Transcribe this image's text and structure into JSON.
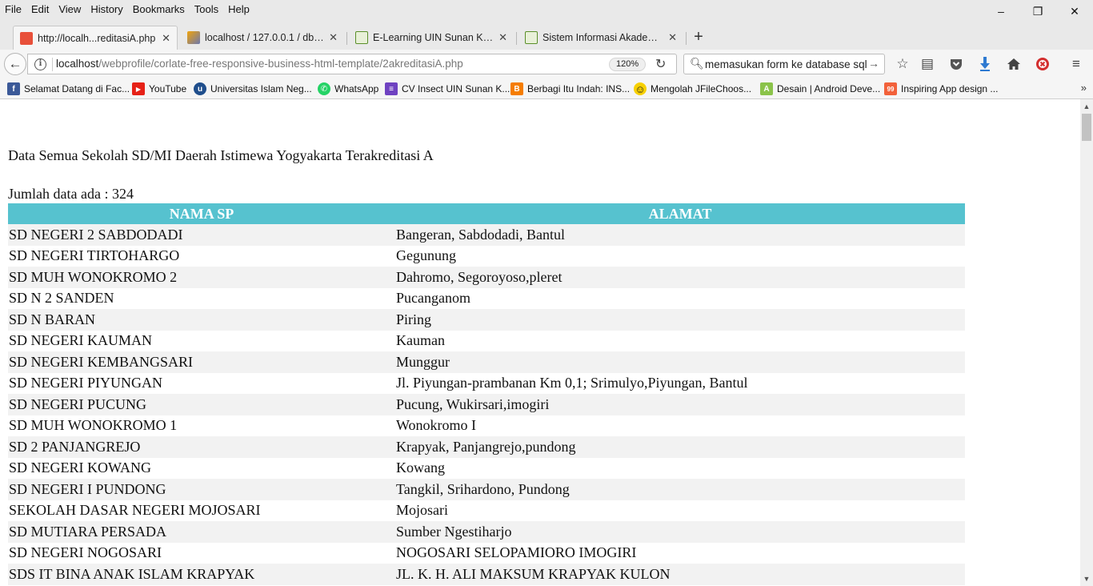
{
  "menubar": {
    "items": [
      "File",
      "Edit",
      "View",
      "History",
      "Bookmarks",
      "Tools",
      "Help"
    ]
  },
  "window_controls": {
    "minimize": "–",
    "restore": "❐",
    "close": "✕"
  },
  "tabs": [
    {
      "title": "http://localh...reditasiA.php",
      "color": "#e8503a"
    },
    {
      "title": "localhost / 127.0.0.1 / db_s...",
      "color": "#f0a30a"
    },
    {
      "title": "E-Learning UIN Sunan Kali...",
      "color": "#5a8f29"
    },
    {
      "title": "Sistem Informasi Akademi...",
      "color": "#5a8f29"
    }
  ],
  "new_tab_label": "+",
  "navbar": {
    "url_host": "localhost",
    "url_path": "/webprofile/corlate-free-responsive-business-html-template/2akreditasiA.php",
    "zoom": "120%",
    "search_value": "memasukan form ke database sql"
  },
  "bookmarks": [
    {
      "label": "Selamat Datang di Fac...",
      "icon": "facebook-icon",
      "color": "#3b5998",
      "glyph": "f"
    },
    {
      "label": "YouTube",
      "icon": "youtube-icon",
      "color": "#e62117",
      "glyph": "▶"
    },
    {
      "label": "Universitas Islam Neg...",
      "icon": "uin-icon",
      "color": "#1f4e8c",
      "glyph": "u"
    },
    {
      "label": "WhatsApp",
      "icon": "whatsapp-icon",
      "color": "#25d366",
      "glyph": "✆"
    },
    {
      "label": "CV Insect UIN Sunan K...",
      "icon": "list-icon",
      "color": "#6f42c1",
      "glyph": "≡"
    },
    {
      "label": "Berbagi Itu Indah: INS...",
      "icon": "blogger-icon",
      "color": "#f57d00",
      "glyph": "B"
    },
    {
      "label": "Mengolah JFileChoos...",
      "icon": "smiley-icon",
      "color": "#f7d000",
      "glyph": "☺"
    },
    {
      "label": "Desain | Android Deve...",
      "icon": "android-icon",
      "color": "#8bc34a",
      "glyph": "A"
    },
    {
      "label": "Inspiring App design ...",
      "icon": "99designs-icon",
      "color": "#f2613a",
      "glyph": "99"
    }
  ],
  "bookmarks_more": "»",
  "page": {
    "heading": "Data Semua Sekolah SD/MI Daerah Istimewa Yogyakarta Terakreditasi A",
    "count_label": "Jumlah data ada : 324",
    "columns": [
      "NAMA SP",
      "ALAMAT"
    ],
    "rows": [
      [
        "SD NEGERI 2 SABDODADI",
        "Bangeran, Sabdodadi, Bantul"
      ],
      [
        "SD NEGERI TIRTOHARGO",
        "Gegunung"
      ],
      [
        "SD MUH WONOKROMO 2",
        "Dahromo, Segoroyoso,pleret"
      ],
      [
        "SD N 2 SANDEN",
        "Pucanganom"
      ],
      [
        "SD N BARAN",
        "Piring"
      ],
      [
        "SD NEGERI KAUMAN",
        "Kauman"
      ],
      [
        "SD NEGERI KEMBANGSARI",
        "Munggur"
      ],
      [
        "SD NEGERI PIYUNGAN",
        "Jl. Piyungan-prambanan Km 0,1; Srimulyo,Piyungan, Bantul"
      ],
      [
        "SD NEGERI PUCUNG",
        "Pucung, Wukirsari,imogiri"
      ],
      [
        "SD MUH WONOKROMO 1",
        "Wonokromo I"
      ],
      [
        "SD 2 PANJANGREJO",
        "Krapyak, Panjangrejo,pundong"
      ],
      [
        "SD NEGERI KOWANG",
        "Kowang"
      ],
      [
        "SD NEGERI I PUNDONG",
        "Tangkil, Srihardono, Pundong"
      ],
      [
        "SEKOLAH DASAR NEGERI MOJOSARI",
        "Mojosari"
      ],
      [
        "SD MUTIARA PERSADA",
        "Sumber Ngestiharjo"
      ],
      [
        "SD NEGERI NOGOSARI",
        "NOGOSARI SELOPAMIORO IMOGIRI"
      ],
      [
        "SDS IT BINA ANAK ISLAM KRAPYAK",
        "JL. K. H. ALI MAKSUM KRAPYAK KULON"
      ]
    ]
  },
  "colors": {
    "table_header": "#56c2cf",
    "row_stripe": "#f2f2f2"
  }
}
